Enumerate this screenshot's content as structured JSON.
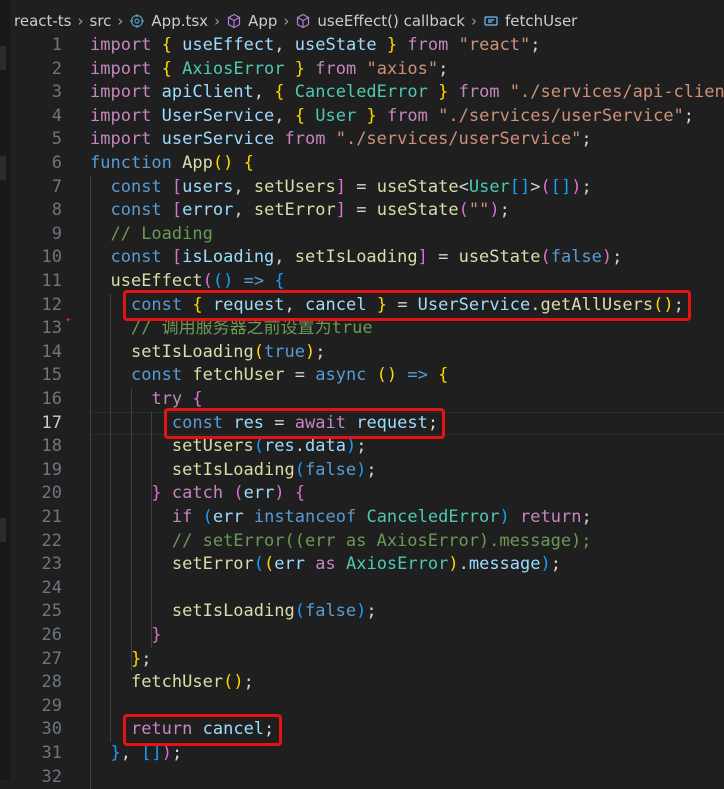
{
  "breadcrumb": {
    "items": [
      "react-ts",
      "src",
      "App.tsx",
      "App",
      "useEffect() callback",
      "fetchUser"
    ]
  },
  "colors": {
    "background": "#1f1f1f",
    "keyword": "#569cd6",
    "control": "#c586c0",
    "function": "#dcdcaa",
    "variable": "#9cdcfe",
    "type": "#4ec9b0",
    "string": "#ce9178",
    "comment": "#6a9955",
    "highlight_box": "#e51414"
  },
  "editor": {
    "active_line": 17,
    "lines": [
      {
        "n": "1",
        "tokens": [
          [
            "kc",
            "import"
          ],
          [
            "op",
            " "
          ],
          [
            "bk",
            "{"
          ],
          [
            "op",
            " "
          ],
          [
            "vr",
            "useEffect"
          ],
          [
            "op",
            ", "
          ],
          [
            "vr",
            "useState"
          ],
          [
            "op",
            " "
          ],
          [
            "bk",
            "}"
          ],
          [
            "op",
            " "
          ],
          [
            "kc",
            "from"
          ],
          [
            "op",
            " "
          ],
          [
            "st",
            "\"react\""
          ],
          [
            "op",
            ";"
          ]
        ]
      },
      {
        "n": "2",
        "tokens": [
          [
            "kc",
            "import"
          ],
          [
            "op",
            " "
          ],
          [
            "bk",
            "{"
          ],
          [
            "op",
            " "
          ],
          [
            "tp",
            "AxiosError"
          ],
          [
            "op",
            " "
          ],
          [
            "bk",
            "}"
          ],
          [
            "op",
            " "
          ],
          [
            "kc",
            "from"
          ],
          [
            "op",
            " "
          ],
          [
            "st",
            "\"axios\""
          ],
          [
            "op",
            ";"
          ]
        ]
      },
      {
        "n": "3",
        "tokens": [
          [
            "kc",
            "import"
          ],
          [
            "op",
            " "
          ],
          [
            "vr",
            "apiClient"
          ],
          [
            "op",
            ", "
          ],
          [
            "bk",
            "{"
          ],
          [
            "op",
            " "
          ],
          [
            "tp",
            "CanceledError"
          ],
          [
            "op",
            " "
          ],
          [
            "bk",
            "}"
          ],
          [
            "op",
            " "
          ],
          [
            "kc",
            "from"
          ],
          [
            "op",
            " "
          ],
          [
            "st",
            "\"./services/api-client\""
          ],
          [
            "op",
            ";"
          ]
        ]
      },
      {
        "n": "4",
        "tokens": [
          [
            "kc",
            "import"
          ],
          [
            "op",
            " "
          ],
          [
            "vr",
            "UserService"
          ],
          [
            "op",
            ", "
          ],
          [
            "bk",
            "{"
          ],
          [
            "op",
            " "
          ],
          [
            "tp",
            "User"
          ],
          [
            "op",
            " "
          ],
          [
            "bk",
            "}"
          ],
          [
            "op",
            " "
          ],
          [
            "kc",
            "from"
          ],
          [
            "op",
            " "
          ],
          [
            "st",
            "\"./services/userService\""
          ],
          [
            "op",
            ";"
          ]
        ]
      },
      {
        "n": "5",
        "tokens": [
          [
            "kc",
            "import"
          ],
          [
            "op",
            " "
          ],
          [
            "vr",
            "userService"
          ],
          [
            "op",
            " "
          ],
          [
            "kc",
            "from"
          ],
          [
            "op",
            " "
          ],
          [
            "st",
            "\"./services/userService\""
          ],
          [
            "op",
            ";"
          ]
        ]
      },
      {
        "n": "6",
        "tokens": [
          [
            "kw",
            "function"
          ],
          [
            "op",
            " "
          ],
          [
            "fn",
            "App"
          ],
          [
            "bk",
            "()"
          ],
          [
            "op",
            " "
          ],
          [
            "bk",
            "{"
          ]
        ]
      },
      {
        "n": "7",
        "tokens": [
          [
            "op",
            "  "
          ],
          [
            "kw",
            "const"
          ],
          [
            "op",
            " "
          ],
          [
            "bp",
            "["
          ],
          [
            "vr",
            "users"
          ],
          [
            "op",
            ", "
          ],
          [
            "fn",
            "setUsers"
          ],
          [
            "bp",
            "]"
          ],
          [
            "op",
            " = "
          ],
          [
            "fn",
            "useState"
          ],
          [
            "op",
            "<"
          ],
          [
            "tp",
            "User"
          ],
          [
            "bb",
            "[]"
          ],
          [
            "op",
            ">"
          ],
          [
            "bp",
            "("
          ],
          [
            "bb",
            "[]"
          ],
          [
            "bp",
            ")"
          ],
          [
            "op",
            ";"
          ]
        ]
      },
      {
        "n": "8",
        "tokens": [
          [
            "op",
            "  "
          ],
          [
            "kw",
            "const"
          ],
          [
            "op",
            " "
          ],
          [
            "bp",
            "["
          ],
          [
            "vr",
            "error"
          ],
          [
            "op",
            ", "
          ],
          [
            "fn",
            "setError"
          ],
          [
            "bp",
            "]"
          ],
          [
            "op",
            " = "
          ],
          [
            "fn",
            "useState"
          ],
          [
            "bp",
            "("
          ],
          [
            "st",
            "\"\""
          ],
          [
            "bp",
            ")"
          ],
          [
            "op",
            ";"
          ]
        ]
      },
      {
        "n": "9",
        "tokens": [
          [
            "op",
            "  "
          ],
          [
            "cm",
            "// Loading"
          ]
        ]
      },
      {
        "n": "10",
        "tokens": [
          [
            "op",
            "  "
          ],
          [
            "kw",
            "const"
          ],
          [
            "op",
            " "
          ],
          [
            "bp",
            "["
          ],
          [
            "vr",
            "isLoading"
          ],
          [
            "op",
            ", "
          ],
          [
            "fn",
            "setIsLoading"
          ],
          [
            "bp",
            "]"
          ],
          [
            "op",
            " = "
          ],
          [
            "fn",
            "useState"
          ],
          [
            "bp",
            "("
          ],
          [
            "kw",
            "false"
          ],
          [
            "bp",
            ")"
          ],
          [
            "op",
            ";"
          ]
        ]
      },
      {
        "n": "11",
        "tokens": [
          [
            "op",
            "  "
          ],
          [
            "fn",
            "useEffect"
          ],
          [
            "bp",
            "("
          ],
          [
            "bb",
            "()"
          ],
          [
            "op",
            " "
          ],
          [
            "kw",
            "=>"
          ],
          [
            "op",
            " "
          ],
          [
            "bb",
            "{"
          ]
        ]
      },
      {
        "n": "12",
        "tokens": [
          [
            "op",
            "    "
          ],
          [
            "kw",
            "const"
          ],
          [
            "op",
            " "
          ],
          [
            "bk",
            "{"
          ],
          [
            "op",
            " "
          ],
          [
            "vr",
            "request"
          ],
          [
            "op",
            ", "
          ],
          [
            "vr",
            "cancel"
          ],
          [
            "op",
            " "
          ],
          [
            "bk",
            "}"
          ],
          [
            "op",
            " = "
          ],
          [
            "vr",
            "UserService"
          ],
          [
            "op",
            "."
          ],
          [
            "fn",
            "getAllUsers"
          ],
          [
            "bk",
            "()"
          ],
          [
            "op",
            ";"
          ]
        ]
      },
      {
        "n": "13",
        "tokens": [
          [
            "op",
            "    "
          ],
          [
            "cm",
            "// 调用服务器之前设置为true"
          ]
        ]
      },
      {
        "n": "14",
        "tokens": [
          [
            "op",
            "    "
          ],
          [
            "fn",
            "setIsLoading"
          ],
          [
            "bk",
            "("
          ],
          [
            "kw",
            "true"
          ],
          [
            "bk",
            ")"
          ],
          [
            "op",
            ";"
          ]
        ]
      },
      {
        "n": "15",
        "tokens": [
          [
            "op",
            "    "
          ],
          [
            "kw",
            "const"
          ],
          [
            "op",
            " "
          ],
          [
            "fn",
            "fetchUser"
          ],
          [
            "op",
            " = "
          ],
          [
            "kw",
            "async"
          ],
          [
            "op",
            " "
          ],
          [
            "bk",
            "()"
          ],
          [
            "op",
            " "
          ],
          [
            "kw",
            "=>"
          ],
          [
            "op",
            " "
          ],
          [
            "bk",
            "{"
          ]
        ]
      },
      {
        "n": "16",
        "tokens": [
          [
            "op",
            "      "
          ],
          [
            "kc",
            "try"
          ],
          [
            "op",
            " "
          ],
          [
            "bp",
            "{"
          ]
        ]
      },
      {
        "n": "17",
        "tokens": [
          [
            "op",
            "        "
          ],
          [
            "kw",
            "const"
          ],
          [
            "op",
            " "
          ],
          [
            "vr",
            "res"
          ],
          [
            "op",
            " = "
          ],
          [
            "kc",
            "await"
          ],
          [
            "op",
            " "
          ],
          [
            "vr",
            "request"
          ],
          [
            "op",
            ";"
          ]
        ]
      },
      {
        "n": "18",
        "tokens": [
          [
            "op",
            "        "
          ],
          [
            "fn",
            "setUsers"
          ],
          [
            "bb",
            "("
          ],
          [
            "vr",
            "res"
          ],
          [
            "op",
            "."
          ],
          [
            "vr",
            "data"
          ],
          [
            "bb",
            ")"
          ],
          [
            "op",
            ";"
          ]
        ]
      },
      {
        "n": "19",
        "tokens": [
          [
            "op",
            "        "
          ],
          [
            "fn",
            "setIsLoading"
          ],
          [
            "bb",
            "("
          ],
          [
            "kw",
            "false"
          ],
          [
            "bb",
            ")"
          ],
          [
            "op",
            ";"
          ]
        ]
      },
      {
        "n": "20",
        "tokens": [
          [
            "op",
            "      "
          ],
          [
            "bp",
            "}"
          ],
          [
            "op",
            " "
          ],
          [
            "kc",
            "catch"
          ],
          [
            "op",
            " "
          ],
          [
            "bp",
            "("
          ],
          [
            "vr",
            "err"
          ],
          [
            "bp",
            ")"
          ],
          [
            "op",
            " "
          ],
          [
            "bp",
            "{"
          ]
        ]
      },
      {
        "n": "21",
        "tokens": [
          [
            "op",
            "        "
          ],
          [
            "kc",
            "if"
          ],
          [
            "op",
            " "
          ],
          [
            "bb",
            "("
          ],
          [
            "vr",
            "err"
          ],
          [
            "op",
            " "
          ],
          [
            "kw",
            "instanceof"
          ],
          [
            "op",
            " "
          ],
          [
            "tp",
            "CanceledError"
          ],
          [
            "bb",
            ")"
          ],
          [
            "op",
            " "
          ],
          [
            "kc",
            "return"
          ],
          [
            "op",
            ";"
          ]
        ]
      },
      {
        "n": "22",
        "tokens": [
          [
            "op",
            "        "
          ],
          [
            "cm",
            "// setError((err as AxiosError).message);"
          ]
        ]
      },
      {
        "n": "23",
        "tokens": [
          [
            "op",
            "        "
          ],
          [
            "fn",
            "setError"
          ],
          [
            "bb",
            "("
          ],
          [
            "bk",
            "("
          ],
          [
            "vr",
            "err"
          ],
          [
            "op",
            " "
          ],
          [
            "kc",
            "as"
          ],
          [
            "op",
            " "
          ],
          [
            "tp",
            "AxiosError"
          ],
          [
            "bk",
            ")"
          ],
          [
            "op",
            "."
          ],
          [
            "vr",
            "message"
          ],
          [
            "bb",
            ")"
          ],
          [
            "op",
            ";"
          ]
        ]
      },
      {
        "n": "24",
        "tokens": []
      },
      {
        "n": "25",
        "tokens": [
          [
            "op",
            "        "
          ],
          [
            "fn",
            "setIsLoading"
          ],
          [
            "bb",
            "("
          ],
          [
            "kw",
            "false"
          ],
          [
            "bb",
            ")"
          ],
          [
            "op",
            ";"
          ]
        ]
      },
      {
        "n": "26",
        "tokens": [
          [
            "op",
            "      "
          ],
          [
            "bp",
            "}"
          ]
        ]
      },
      {
        "n": "27",
        "tokens": [
          [
            "op",
            "    "
          ],
          [
            "bk",
            "}"
          ],
          [
            "op",
            ";"
          ]
        ]
      },
      {
        "n": "28",
        "tokens": [
          [
            "op",
            "    "
          ],
          [
            "fn",
            "fetchUser"
          ],
          [
            "bk",
            "()"
          ],
          [
            "op",
            ";"
          ]
        ]
      },
      {
        "n": "29",
        "tokens": []
      },
      {
        "n": "30",
        "tokens": [
          [
            "op",
            "    "
          ],
          [
            "kc",
            "return"
          ],
          [
            "op",
            " "
          ],
          [
            "vr",
            "cancel"
          ],
          [
            "op",
            ";"
          ]
        ]
      },
      {
        "n": "31",
        "tokens": [
          [
            "op",
            "  "
          ],
          [
            "bb",
            "}"
          ],
          [
            "op",
            ", "
          ],
          [
            "bb",
            "[]"
          ],
          [
            "bp",
            ")"
          ],
          [
            "op",
            ";"
          ]
        ]
      },
      {
        "n": "32",
        "tokens": []
      }
    ]
  },
  "highlights": [
    {
      "line": 12,
      "label": "const { request, cancel } = UserService.getAllUsers();"
    },
    {
      "line": 17,
      "label": "const res = await request;"
    },
    {
      "line": 30,
      "label": "return cancel;"
    }
  ]
}
